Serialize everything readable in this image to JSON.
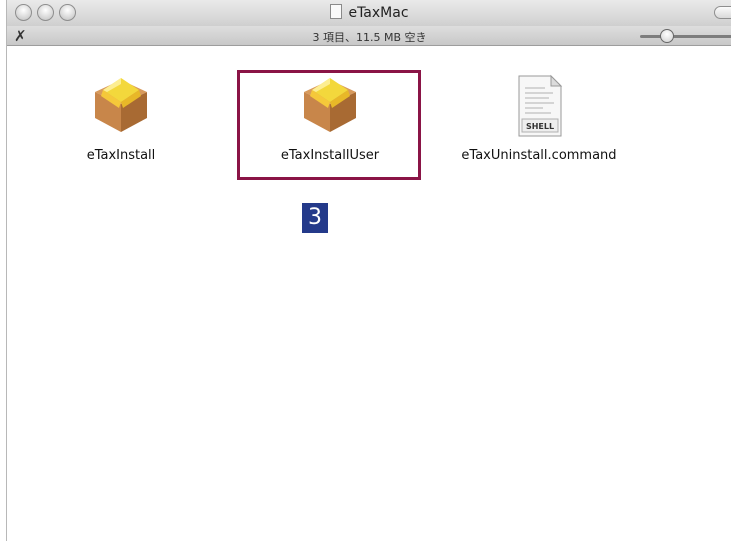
{
  "window": {
    "title": "eTaxMac",
    "status": "3 項目、11.5 MB 空き"
  },
  "files": [
    {
      "name": "eTaxInstall",
      "icon": "package-icon"
    },
    {
      "name": "eTaxInstallUser",
      "icon": "package-icon",
      "selected": true
    },
    {
      "name": "eTaxUninstall.command",
      "icon": "shell-script-icon",
      "icon_text": "SHELL"
    }
  ],
  "annotation": {
    "step": "3",
    "color": "#243a8a",
    "highlight_color": "#8a1446"
  }
}
